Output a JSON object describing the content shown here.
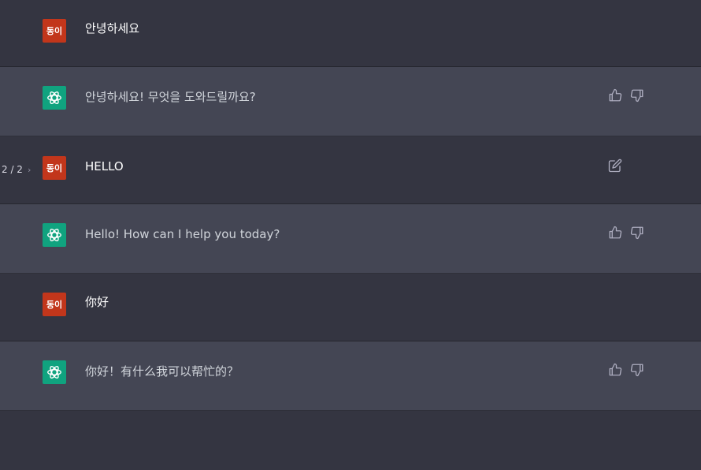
{
  "messages": [
    {
      "role": "user",
      "avatar_label": "동이",
      "text": "안녕하세요"
    },
    {
      "role": "assistant",
      "text": "안녕하세요! 무엇을 도와드릴까요?"
    },
    {
      "role": "user",
      "avatar_label": "동이",
      "text": "HELLO",
      "pager": "2 / 2"
    },
    {
      "role": "assistant",
      "text": "Hello! How can I help you today?"
    },
    {
      "role": "user",
      "avatar_label": "동이",
      "text": "你好"
    },
    {
      "role": "assistant",
      "text": "你好！有什么我可以帮忙的？"
    }
  ],
  "colors": {
    "user_bg": "#343541",
    "assistant_bg": "#444654",
    "user_avatar": "#c2361b",
    "assistant_avatar": "#10a37f"
  },
  "icons": {
    "assistant_logo": "openai-logo-icon",
    "like": "thumbs-up-icon",
    "dislike": "thumbs-down-icon",
    "edit": "edit-icon",
    "next": "chevron-right-icon"
  }
}
